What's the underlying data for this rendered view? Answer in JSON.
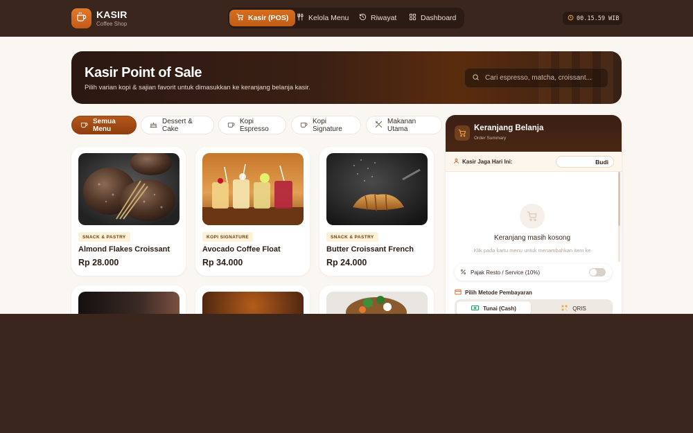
{
  "brand": {
    "name": "KASIR",
    "subtitle": "Coffee Shop",
    "icon": "coffee-cup-icon"
  },
  "nav": [
    {
      "label": "Kasir (POS)",
      "icon": "cart-icon",
      "active": true
    },
    {
      "label": "Kelola Menu",
      "icon": "utensils-icon",
      "active": false
    },
    {
      "label": "Riwayat",
      "icon": "history-icon",
      "active": false
    },
    {
      "label": "Dashboard",
      "icon": "grid-icon",
      "active": false
    }
  ],
  "clock": {
    "time": "00.15.59 WIB",
    "icon": "clock-icon"
  },
  "hero": {
    "title": "Kasir Point of Sale",
    "subtitle": "Pilih varian kopi & sajian favorit untuk dimasukkan ke keranjang belanja kasir.",
    "search_placeholder": "Cari espresso, matcha, croissant..."
  },
  "categories": [
    {
      "label": "Semua Menu",
      "icon": "coffee-cup-icon",
      "active": true
    },
    {
      "label": "Dessert & Cake",
      "icon": "cake-icon",
      "active": false
    },
    {
      "label": "Kopi Espresso",
      "icon": "coffee-cup-icon",
      "active": false
    },
    {
      "label": "Kopi Signature",
      "icon": "coffee-cup-icon",
      "active": false
    },
    {
      "label": "Makanan Utama",
      "icon": "utensils-cross-icon",
      "active": false
    }
  ],
  "products": [
    {
      "category": "SNACK & PASTRY",
      "name": "Almond Flakes Croissant",
      "price": "Rp 28.000",
      "image": "bread-photo"
    },
    {
      "category": "KOPI SIGNATURE",
      "name": "Avocado Coffee Float",
      "price": "Rp 34.000",
      "image": "drinks-photo"
    },
    {
      "category": "SNACK & PASTRY",
      "name": "Butter Croissant French",
      "price": "Rp 24.000",
      "image": "croissant-photo"
    }
  ],
  "cart": {
    "title": "Keranjang Belanja",
    "subtitle": "Order Summary",
    "cashier_label": "Kasir Jaga Hari Ini:",
    "cashier_name": "Budi",
    "empty_title": "Keranjang masih kosong",
    "empty_sub": "Klik pada kartu menu untuk menambahkan item ke",
    "tax_label": "Pajak Resto / Service (10%)",
    "tax_enabled": false,
    "payment_label": "Pilih Metode Pembayaran",
    "payment_options": [
      {
        "label": "Tunai (Cash)",
        "active": true
      },
      {
        "label": "QRIS",
        "active": false
      }
    ]
  },
  "colors": {
    "accent": "#c9621a",
    "dark": "#3a261d",
    "background": "#faf6f2"
  }
}
